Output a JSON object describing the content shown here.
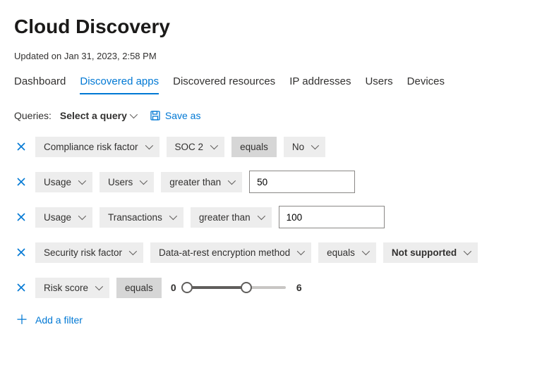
{
  "header": {
    "title": "Cloud Discovery",
    "updated": "Updated on Jan 31, 2023, 2:58 PM"
  },
  "tabs": [
    {
      "label": "Dashboard",
      "active": false
    },
    {
      "label": "Discovered apps",
      "active": true
    },
    {
      "label": "Discovered resources",
      "active": false
    },
    {
      "label": "IP addresses",
      "active": false
    },
    {
      "label": "Users",
      "active": false
    },
    {
      "label": "Devices",
      "active": false
    }
  ],
  "queries": {
    "label": "Queries:",
    "select": "Select a query",
    "save_as": "Save as"
  },
  "filters": [
    {
      "field": "Compliance risk factor",
      "subfield": "SOC 2",
      "operator": "equals",
      "operator_dark": true,
      "value_chip": "No"
    },
    {
      "field": "Usage",
      "subfield": "Users",
      "operator": "greater than",
      "value_input": "50"
    },
    {
      "field": "Usage",
      "subfield": "Transactions",
      "operator": "greater than",
      "value_input": "100"
    },
    {
      "field": "Security risk factor",
      "subfield": "Data-at-rest encryption method",
      "operator": "equals",
      "value_chip": "Not supported",
      "value_bold": true
    },
    {
      "field": "Risk score",
      "operator": "equals",
      "operator_dark": true,
      "slider": {
        "min": 0,
        "max": 6,
        "range_max": 10
      }
    }
  ],
  "add_filter": "Add a filter"
}
